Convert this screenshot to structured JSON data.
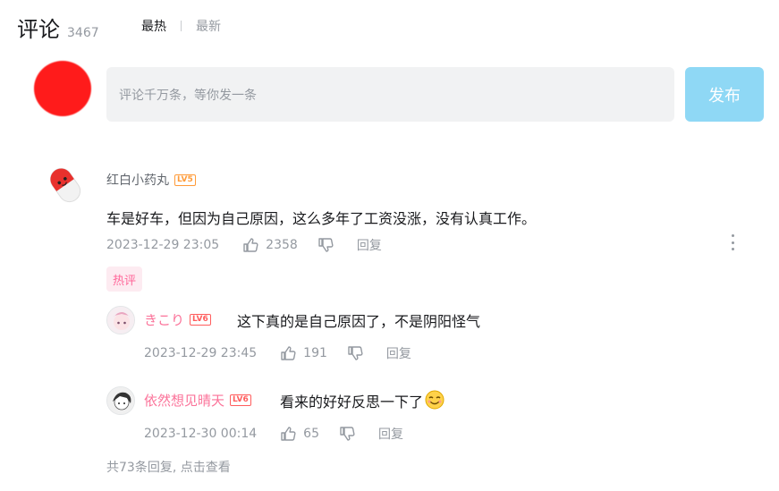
{
  "header": {
    "title": "评论",
    "count": "3467",
    "sort_hot": "最热",
    "sort_new": "最新"
  },
  "composer": {
    "placeholder": "评论千万条，等你发一条",
    "publish_label": "发布"
  },
  "comment": {
    "user": "红白小药丸",
    "level": "LV5",
    "content": "车是好车，但因为自己原因，这么多年了工资没涨，没有认真工作。",
    "date": "2023-12-29 23:05",
    "likes": "2358",
    "reply_label": "回复",
    "tag": "热评"
  },
  "replies": [
    {
      "user": "きこり",
      "level": "LV6",
      "content": "这下真的是自己原因了，不是阴阳怪气",
      "date": "2023-12-29 23:45",
      "likes": "191",
      "reply_label": "回复"
    },
    {
      "user": "依然想见晴天",
      "level": "LV6",
      "content": "看来的好好反思一下了",
      "date": "2023-12-30 00:14",
      "likes": "65",
      "reply_label": "回复"
    }
  ],
  "view_more": "共73条回复, 点击查看",
  "colors": {
    "accent_pink": "#fb7299",
    "publish_bg": "#8fd8f5",
    "muted": "#9499a0"
  }
}
